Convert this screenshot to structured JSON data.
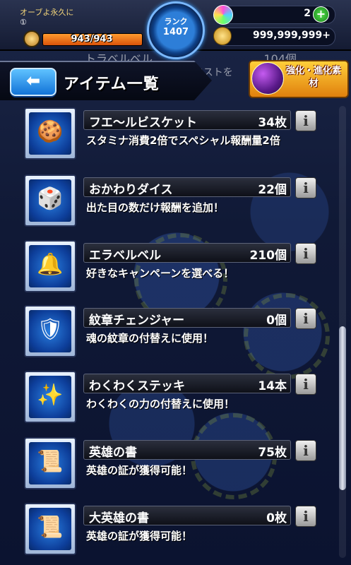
{
  "hud": {
    "player_name": "オーブよ永久に",
    "player_level": "①",
    "stamina": "943/943",
    "stamina_fraction": 1.0,
    "rank_label": "ランク",
    "rank_value": "1407",
    "orbs": "2",
    "plus": "+",
    "gold": "999,999,999+"
  },
  "header": {
    "back_arrow": "⬅",
    "title": "アイテム一覧",
    "evolve_button": "強化・進化素材",
    "behind_item": {
      "name": "トラベルベル",
      "count": "104個",
      "desc": "タイムシフトで好きなクエストを"
    }
  },
  "items": [
    {
      "name": "フエ〜ルビスケット",
      "count": "34枚",
      "desc": "スタミナ消費2倍でスペシャル報酬量2倍",
      "icon": "biscuit-icon",
      "glyph": "🍪"
    },
    {
      "name": "おかわりダイス",
      "count": "22個",
      "desc": "出た目の数だけ報酬を追加！",
      "icon": "dice-icon",
      "glyph": "🎲"
    },
    {
      "name": "エラベルベル",
      "count": "210個",
      "desc": "好きなキャンペーンを選べる！",
      "icon": "bell-icon",
      "glyph": "🔔"
    },
    {
      "name": "紋章チェンジャー",
      "count": "0個",
      "desc": "魂の紋章の付替えに使用！",
      "icon": "crest-changer-icon",
      "glyph": "🛡"
    },
    {
      "name": "わくわくステッキ",
      "count": "14本",
      "desc": "わくわくの力の付替えに使用！",
      "icon": "wand-icon",
      "glyph": "✨"
    },
    {
      "name": "英雄の書",
      "count": "75枚",
      "desc": "英雄の証が獲得可能！",
      "icon": "hero-scroll-icon",
      "glyph": "📜"
    },
    {
      "name": "大英雄の書",
      "count": "0枚",
      "desc": "英雄の証が獲得可能！",
      "icon": "great-hero-scroll-icon",
      "glyph": "📜"
    }
  ],
  "info_label": "i"
}
